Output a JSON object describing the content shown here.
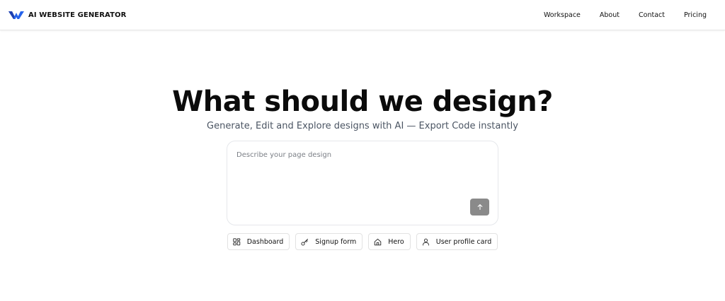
{
  "brand": {
    "name": "AI WEBSITE GENERATOR",
    "logo_icon": "w-logo-icon",
    "accent_color": "#2563eb"
  },
  "nav": {
    "links": [
      "Workspace",
      "About",
      "Contact",
      "Pricing"
    ]
  },
  "hero": {
    "title": "What should we design?",
    "subtitle": "Generate, Edit and Explore designs with AI — Export Code instantly"
  },
  "prompt": {
    "placeholder": "Describe your page design",
    "value": "",
    "send_icon": "arrow-up-icon",
    "send_button_color": "#8a8a8a"
  },
  "suggestions": [
    {
      "label": "Dashboard",
      "icon": "dashboard-icon"
    },
    {
      "label": "Signup form",
      "icon": "key-icon"
    },
    {
      "label": "Hero",
      "icon": "home-icon"
    },
    {
      "label": "User profile card",
      "icon": "user-icon"
    }
  ]
}
